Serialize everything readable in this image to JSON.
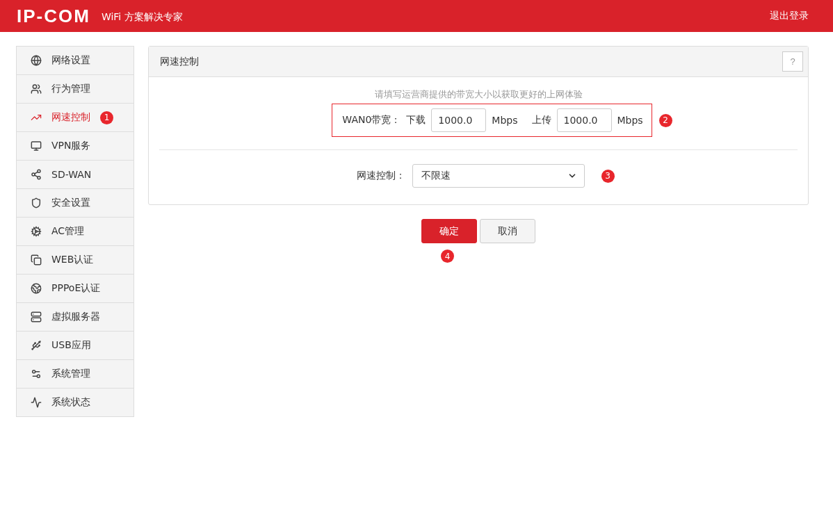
{
  "header": {
    "logo": "IP-COM",
    "tagline": "WiFi 方案解决专家",
    "logout": "退出登录"
  },
  "sidebar": {
    "items": [
      {
        "kind": "globe",
        "label": "网络设置",
        "selected": false
      },
      {
        "kind": "users",
        "label": "行为管理",
        "selected": false
      },
      {
        "kind": "trend",
        "label": "网速控制",
        "selected": true,
        "marker": "1"
      },
      {
        "kind": "monitor",
        "label": "VPN服务",
        "selected": false
      },
      {
        "kind": "share",
        "label": "SD-WAN",
        "selected": false
      },
      {
        "kind": "shield",
        "label": "安全设置",
        "selected": false
      },
      {
        "kind": "cog",
        "label": "AC管理",
        "selected": false
      },
      {
        "kind": "copy",
        "label": "WEB认证",
        "selected": false
      },
      {
        "kind": "earth",
        "label": "PPPoE认证",
        "selected": false
      },
      {
        "kind": "server",
        "label": "虚拟服务器",
        "selected": false
      },
      {
        "kind": "usb",
        "label": "USB应用",
        "selected": false
      },
      {
        "kind": "cogs",
        "label": "系统管理",
        "selected": false
      },
      {
        "kind": "pulse",
        "label": "系统状态",
        "selected": false
      }
    ]
  },
  "panel": {
    "title": "网速控制",
    "help": "?",
    "hint": "请填写运营商提供的带宽大小以获取更好的上网体验",
    "bandwidth": {
      "label": "WAN0带宽：",
      "download_label": "下载",
      "download": "1000.0",
      "download_unit": "Mbps",
      "upload_label": "上传",
      "upload": "1000.0",
      "upload_unit": "Mbps",
      "marker": "2"
    },
    "speed_control": {
      "label": "网速控制：",
      "value": "不限速",
      "marker": "3"
    }
  },
  "buttons": {
    "confirm": "确定",
    "cancel": "取消",
    "marker": "4"
  }
}
